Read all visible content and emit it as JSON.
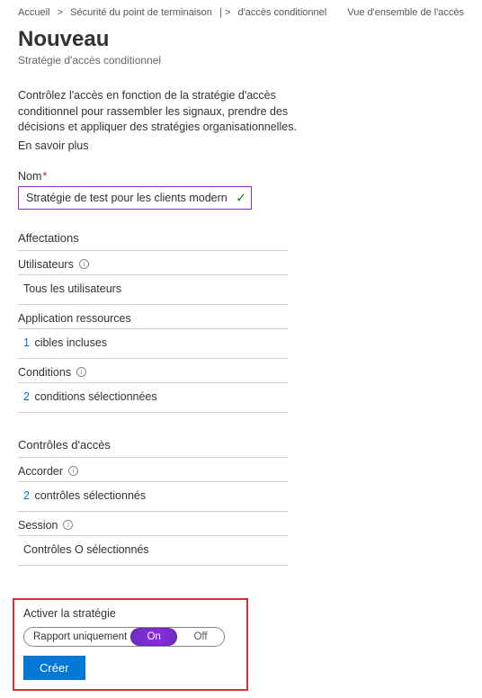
{
  "breadcrumb": {
    "home": "Accueil",
    "sep": "&gt;",
    "endpoint": "Sécurité du point de terminaison",
    "sep2": "| &gt;",
    "cond": "d'accès conditionnel",
    "overview": "Vue d'ensemble de l'accès conditionnel | &gt;"
  },
  "title": "Nouveau",
  "subtitle": "Stratégie d'accès conditionnel",
  "description": "Contrôlez l'accès en fonction de la stratégie d'accès conditionnel pour rassembler les signaux, prendre des décisions et appliquer des stratégies organisationnelles.",
  "learn_more": "En savoir plus",
  "name": {
    "label": "Nom",
    "value": "Stratégie de test pour les clients modernes"
  },
  "assignments": {
    "heading": "Affectations",
    "users": {
      "label": "Utilisateurs",
      "value": "Tous les utilisateurs"
    },
    "apps": {
      "label": "Application ressources",
      "count": "1",
      "text": "cibles incluses"
    },
    "conditions": {
      "label": "Conditions",
      "count": "2",
      "text": "conditions sélectionnées"
    }
  },
  "access": {
    "heading": "Contrôles d'accès",
    "grant": {
      "label": "Accorder",
      "count": "2",
      "text": "contrôles sélectionnés"
    },
    "session": {
      "label": "Session",
      "value": "Contrôles O sélectionnés"
    }
  },
  "footer": {
    "label": "Activer la stratégie",
    "report": "Rapport uniquement",
    "on": "On",
    "off": "Off",
    "create": "Créer"
  }
}
